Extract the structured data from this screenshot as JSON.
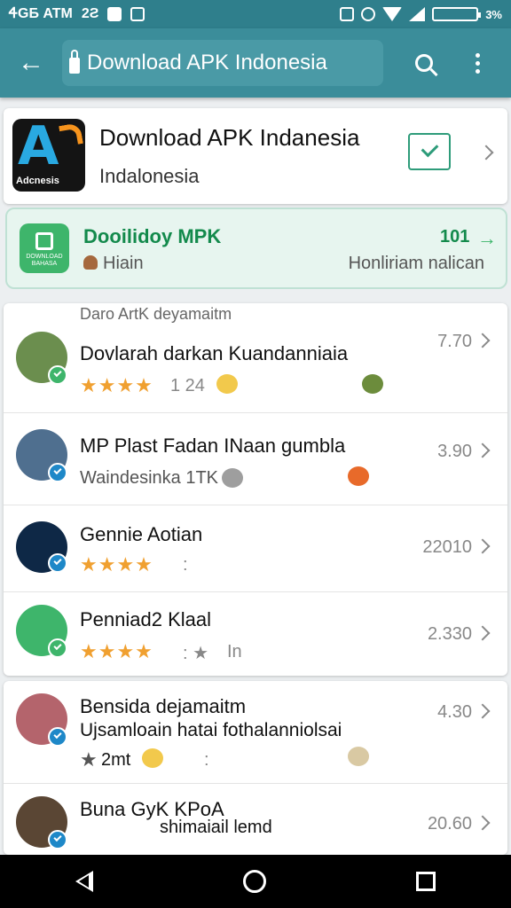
{
  "status_bar": {
    "left_text": "ᏎGБ ATM",
    "left_icon_text": "2Ƨ",
    "right_text": "3%",
    "colors": {
      "background": "#2f7f8c"
    }
  },
  "toolbar": {
    "url": "Download APK Indonesia",
    "icons": [
      "back-arrow-icon",
      "lock-icon",
      "search-icon",
      "more-vert-icon"
    ]
  },
  "app_card": {
    "logo_text": "Adcnesis",
    "title": "Download APK Indanesia",
    "subtitle": "Indalonesia"
  },
  "promo": {
    "icon_text": "DOWNLOAD BAHASA",
    "title": "Dooilidoy MPK",
    "subtitle": "Hiain",
    "count": "101",
    "right_text": "Honliriam nalican",
    "accent": "#138a4c"
  },
  "list_header": "Daro ArtK deyamaitm",
  "reviews": [
    {
      "title": "Dovlarah darkan Kuandanniaia",
      "stars": "★★★★",
      "meta": "1 24",
      "rating": "7.70"
    },
    {
      "title": "MP Plast Fadan INaan gumbla",
      "sub": "Waindesinka 1TK",
      "rating": "3.90"
    },
    {
      "title": "Gennie Aotian",
      "stars": "★★★★",
      "meta": ":",
      "rating": "22010"
    },
    {
      "title": "Penniad2 Klaal",
      "stars": "★★★★",
      "meta": ": ★",
      "meta2": "In",
      "rating": "2.330"
    }
  ],
  "reviews_b": [
    {
      "title": "Bensida dejamaitm",
      "sub": "Ujsamloain hatai fothalanniolsai",
      "stars": "★",
      "meta": "2mt",
      "meta2": ":",
      "rating": "4.30"
    },
    {
      "title": "Buna GyK KPoA",
      "sub": "shimaiail lemd",
      "rating": "20.60"
    }
  ]
}
